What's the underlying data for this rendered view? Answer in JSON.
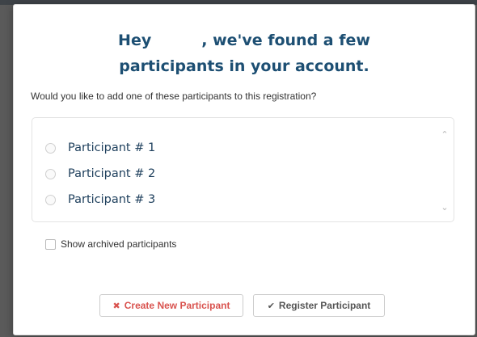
{
  "dialog": {
    "title_line1_prefix": "Hey",
    "title_line1_suffix": ", we've found a few",
    "title_line2": "participants in your account.",
    "question": "Would you like to add one of these participants to this registration?",
    "participants": [
      {
        "label": "Participant # 1",
        "selected": false
      },
      {
        "label": "Participant # 2",
        "selected": false
      },
      {
        "label": "Participant # 3",
        "selected": false
      }
    ],
    "scroll_up_icon": "chevron-up-icon",
    "scroll_down_icon": "chevron-down-icon",
    "show_archived": {
      "label": "Show archived participants",
      "checked": false
    },
    "buttons": {
      "create": {
        "label": "Create New Participant",
        "icon": "close-icon",
        "color": "#d9534f"
      },
      "register": {
        "label": "Register Participant",
        "icon": "check-icon",
        "color": "#555555"
      }
    },
    "title_color": "#1d4f73"
  }
}
